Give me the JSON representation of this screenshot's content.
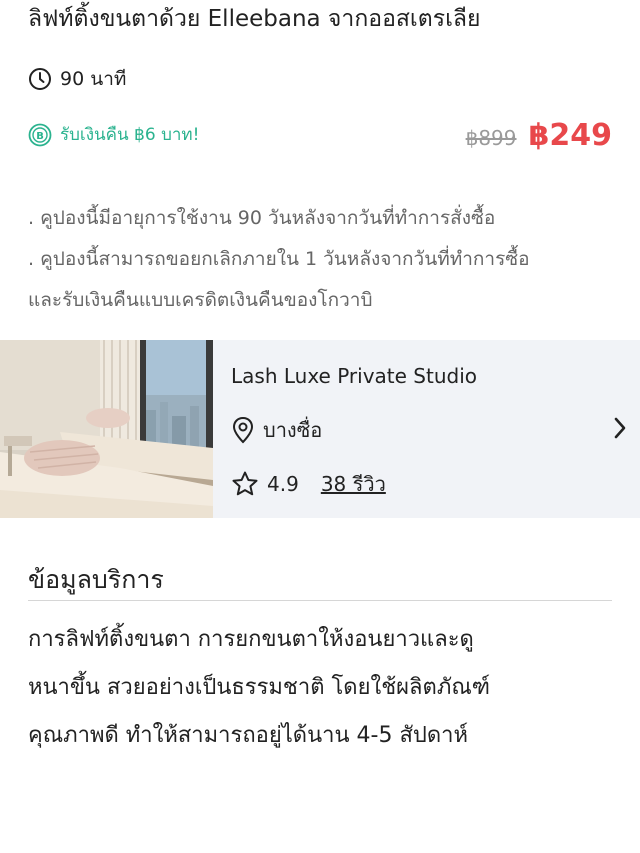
{
  "title": "ลิฟท์ติ้งขนตาด้วย Elleebana จากออสเตรเลีย",
  "duration": {
    "icon": "clock-icon",
    "text": "90 นาที"
  },
  "cashback": {
    "icon": "coin-icon",
    "text": "รับเงินคืน ฿6 บาท!"
  },
  "price": {
    "original": "฿899",
    "current": "฿249"
  },
  "notes": [
    ". คูปองนี้มีอายุการใช้งาน 90 วันหลังจากวันที่ทำการสั่งซื้อ",
    ". คูปองนี้สามารถขอยกเลิกภายใน 1 วันหลังจากวันที่ทำการซื้อ",
    "และรับเงินคืนแบบเครดิตเงินคืนของโกวาบิ"
  ],
  "shop": {
    "name": "Lash Luxe Private Studio",
    "location": "บางซื่อ",
    "rating": "4.9",
    "reviews": "38 รีวิว"
  },
  "service_info": {
    "heading": "ข้อมูลบริการ",
    "lines": [
      "การลิฟท์ติ้งขนตา การยกขนตาให้งอนยาวและดู",
      "หนาขึ้น สวยอย่างเป็นธรรมชาติ โดยใช้ผลิตภัณฑ์",
      "คุณภาพดี ทำให้สามารถอยู่ได้นาน 4-5 สัปดาห์"
    ]
  },
  "colors": {
    "accent_red": "#e8484b",
    "cashback_green": "#2bb38f",
    "card_bg": "#f1f3f7"
  }
}
